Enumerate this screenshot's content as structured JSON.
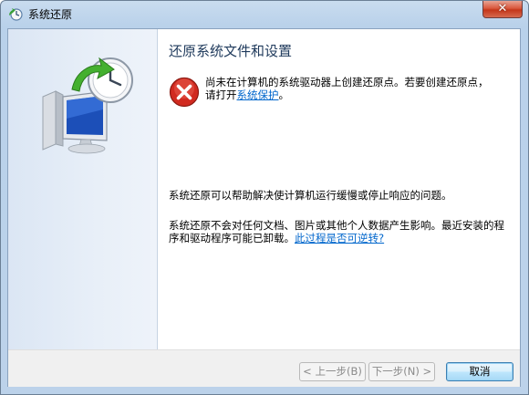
{
  "window": {
    "title": "系统还原",
    "close_label": "✕"
  },
  "main": {
    "heading": "还原系统文件和设置",
    "error_text_before": "尚未在计算机的系统驱动器上创建还原点。若要创建还原点，请打开",
    "error_link": "系统保护",
    "error_text_after": "。",
    "para1": "系统还原可以帮助解决使计算机运行缓慢或停止响应的问题。",
    "para2_text": "系统还原不会对任何文档、图片或其他个人数据产生影响。最近安装的程序和驱动程序可能已卸载。",
    "para2_link": "此过程是否可逆转?"
  },
  "footer": {
    "back_label": "< 上一步(B)",
    "next_label": "下一步(N) >",
    "cancel_label": "取消"
  },
  "icons": {
    "title": "system-restore-icon",
    "sidebar": "computer-clock-restore-icon",
    "error": "error-x-icon"
  },
  "colors": {
    "heading": "#1e395b",
    "link": "#0066cc",
    "error_red": "#c8102e"
  }
}
